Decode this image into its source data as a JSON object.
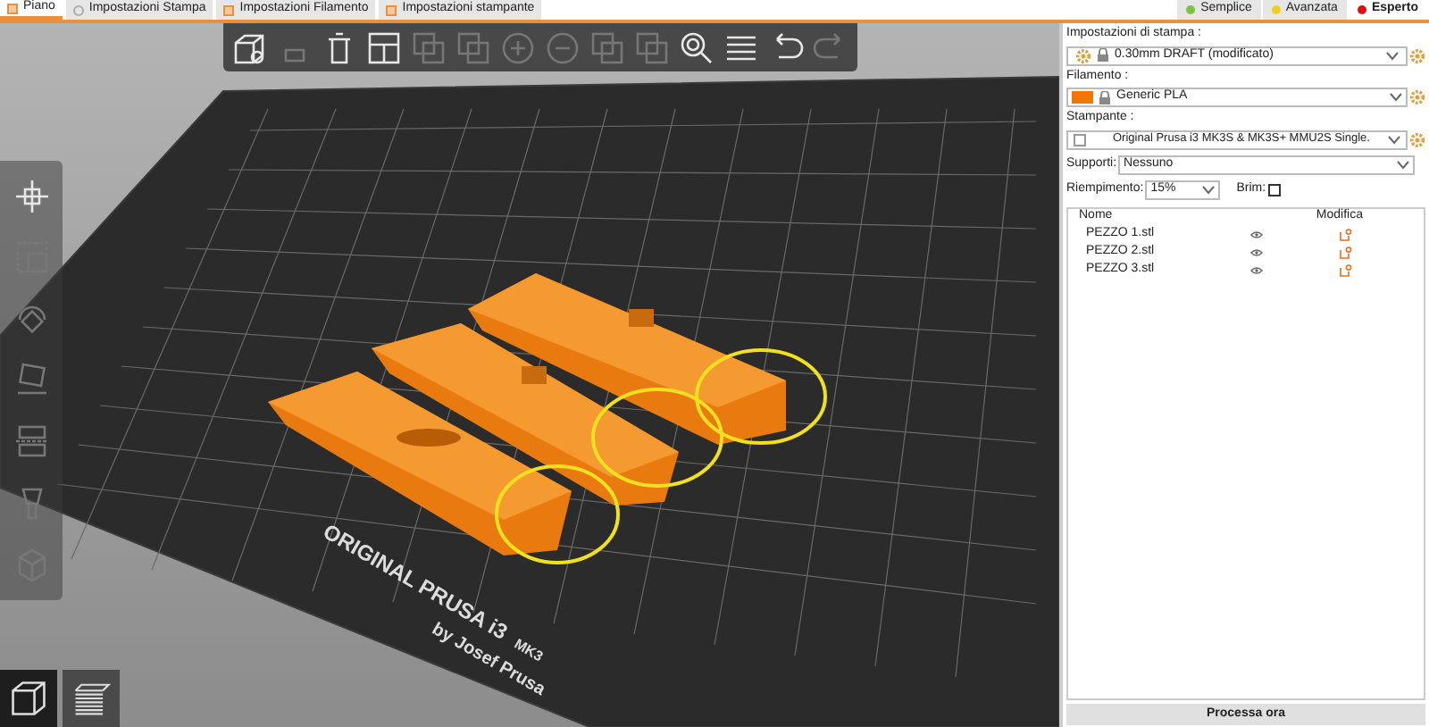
{
  "tabs": [
    {
      "label": "Piano",
      "selected": true
    },
    {
      "label": "Impostazioni Stampa",
      "selected": false
    },
    {
      "label": "Impostazioni Filamento",
      "selected": false
    },
    {
      "label": "Impostazioni stampante",
      "selected": false
    }
  ],
  "modes": [
    {
      "label": "Semplice",
      "color": "#7ec242",
      "selected": false
    },
    {
      "label": "Avanzata",
      "color": "#f0d020",
      "selected": false
    },
    {
      "label": "Esperto",
      "color": "#e01010",
      "selected": true
    }
  ],
  "bed_text": {
    "line_1": "ORIGINAL PRUSA i3",
    "line_2": "MK3",
    "line_3": "by Josef Prusa"
  },
  "sidebar": {
    "print_settings": {
      "label": "Impostazioni di stampa :",
      "value": "0.30mm DRAFT (modificato)"
    },
    "filament": {
      "label": "Filamento :",
      "value": "Generic PLA",
      "color": "#f07800"
    },
    "printer": {
      "label": "Stampante :",
      "value": "Original Prusa i3 MK3S & MK3S+ MMU2S Single."
    },
    "supports": {
      "label": "Supporti:",
      "value": "Nessuno"
    },
    "infill": {
      "label": "Riempimento:",
      "value": "15%"
    },
    "brim": {
      "label": "Brim:",
      "checked": false
    },
    "objects": {
      "columns": [
        "Nome",
        "Modifica"
      ],
      "rows": [
        {
          "name": "PEZZO 1.stl"
        },
        {
          "name": "PEZZO 2.stl"
        },
        {
          "name": "PEZZO 3.stl"
        }
      ]
    },
    "process_button": "Processa ora"
  }
}
